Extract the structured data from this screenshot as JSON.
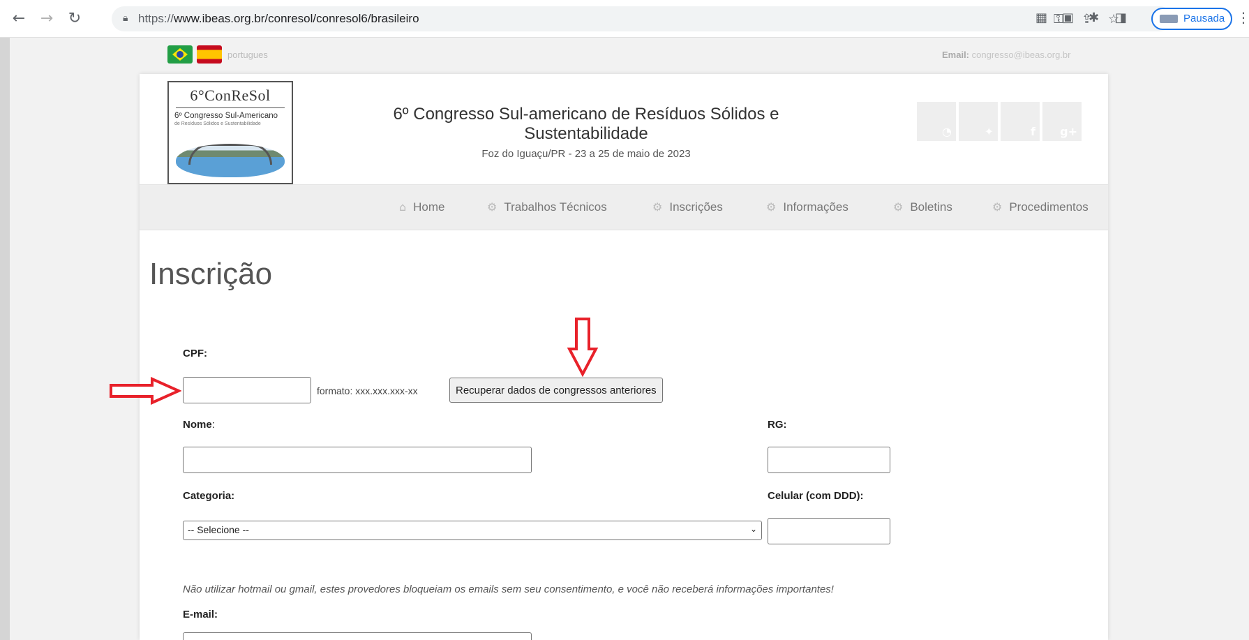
{
  "browser": {
    "url_proto": "https://",
    "url_rest": "www.ibeas.org.br/conresol/conresol6/brasileiro",
    "profile_status": "Pausada"
  },
  "top": {
    "language": "portugues",
    "email_label": "Email:",
    "email_value": "congresso@ibeas.org.br"
  },
  "logo": {
    "line1": "6°ConReSol",
    "line2": "6º Congresso Sul-Americano",
    "line3": "de Resíduos Sólidos e Sustentabilidade"
  },
  "header": {
    "title": "6º Congresso Sul-americano de Resíduos Sólidos e Sustentabilidade",
    "subtitle": "Foz do Iguaçu/PR - 23 a 25 de maio de 2023"
  },
  "nav": {
    "items": [
      "Home",
      "Trabalhos Técnicos",
      "Inscrições",
      "Informações",
      "Boletins",
      "Procedimentos"
    ]
  },
  "page": {
    "heading": "Inscrição"
  },
  "form": {
    "cpf_label": "CPF:",
    "cpf_format": "formato: xxx.xxx.xxx-xx",
    "recover_button": "Recuperar dados de congressos anteriores",
    "nome_label": "Nome",
    "nome_colon": ":",
    "rg_label": "RG:",
    "categoria_label": "Categoria:",
    "categoria_selected": "-- Selecione --",
    "celular_label": "Celular (com DDD):",
    "warning": "Não utilizar hotmail ou gmail, estes provedores bloqueiam os emails sem seu consentimento, e você não receberá informações importantes!",
    "email_label": "E-mail:"
  },
  "colors": {
    "arrow": "#e8212a",
    "accent_blue": "#1a73e8"
  }
}
